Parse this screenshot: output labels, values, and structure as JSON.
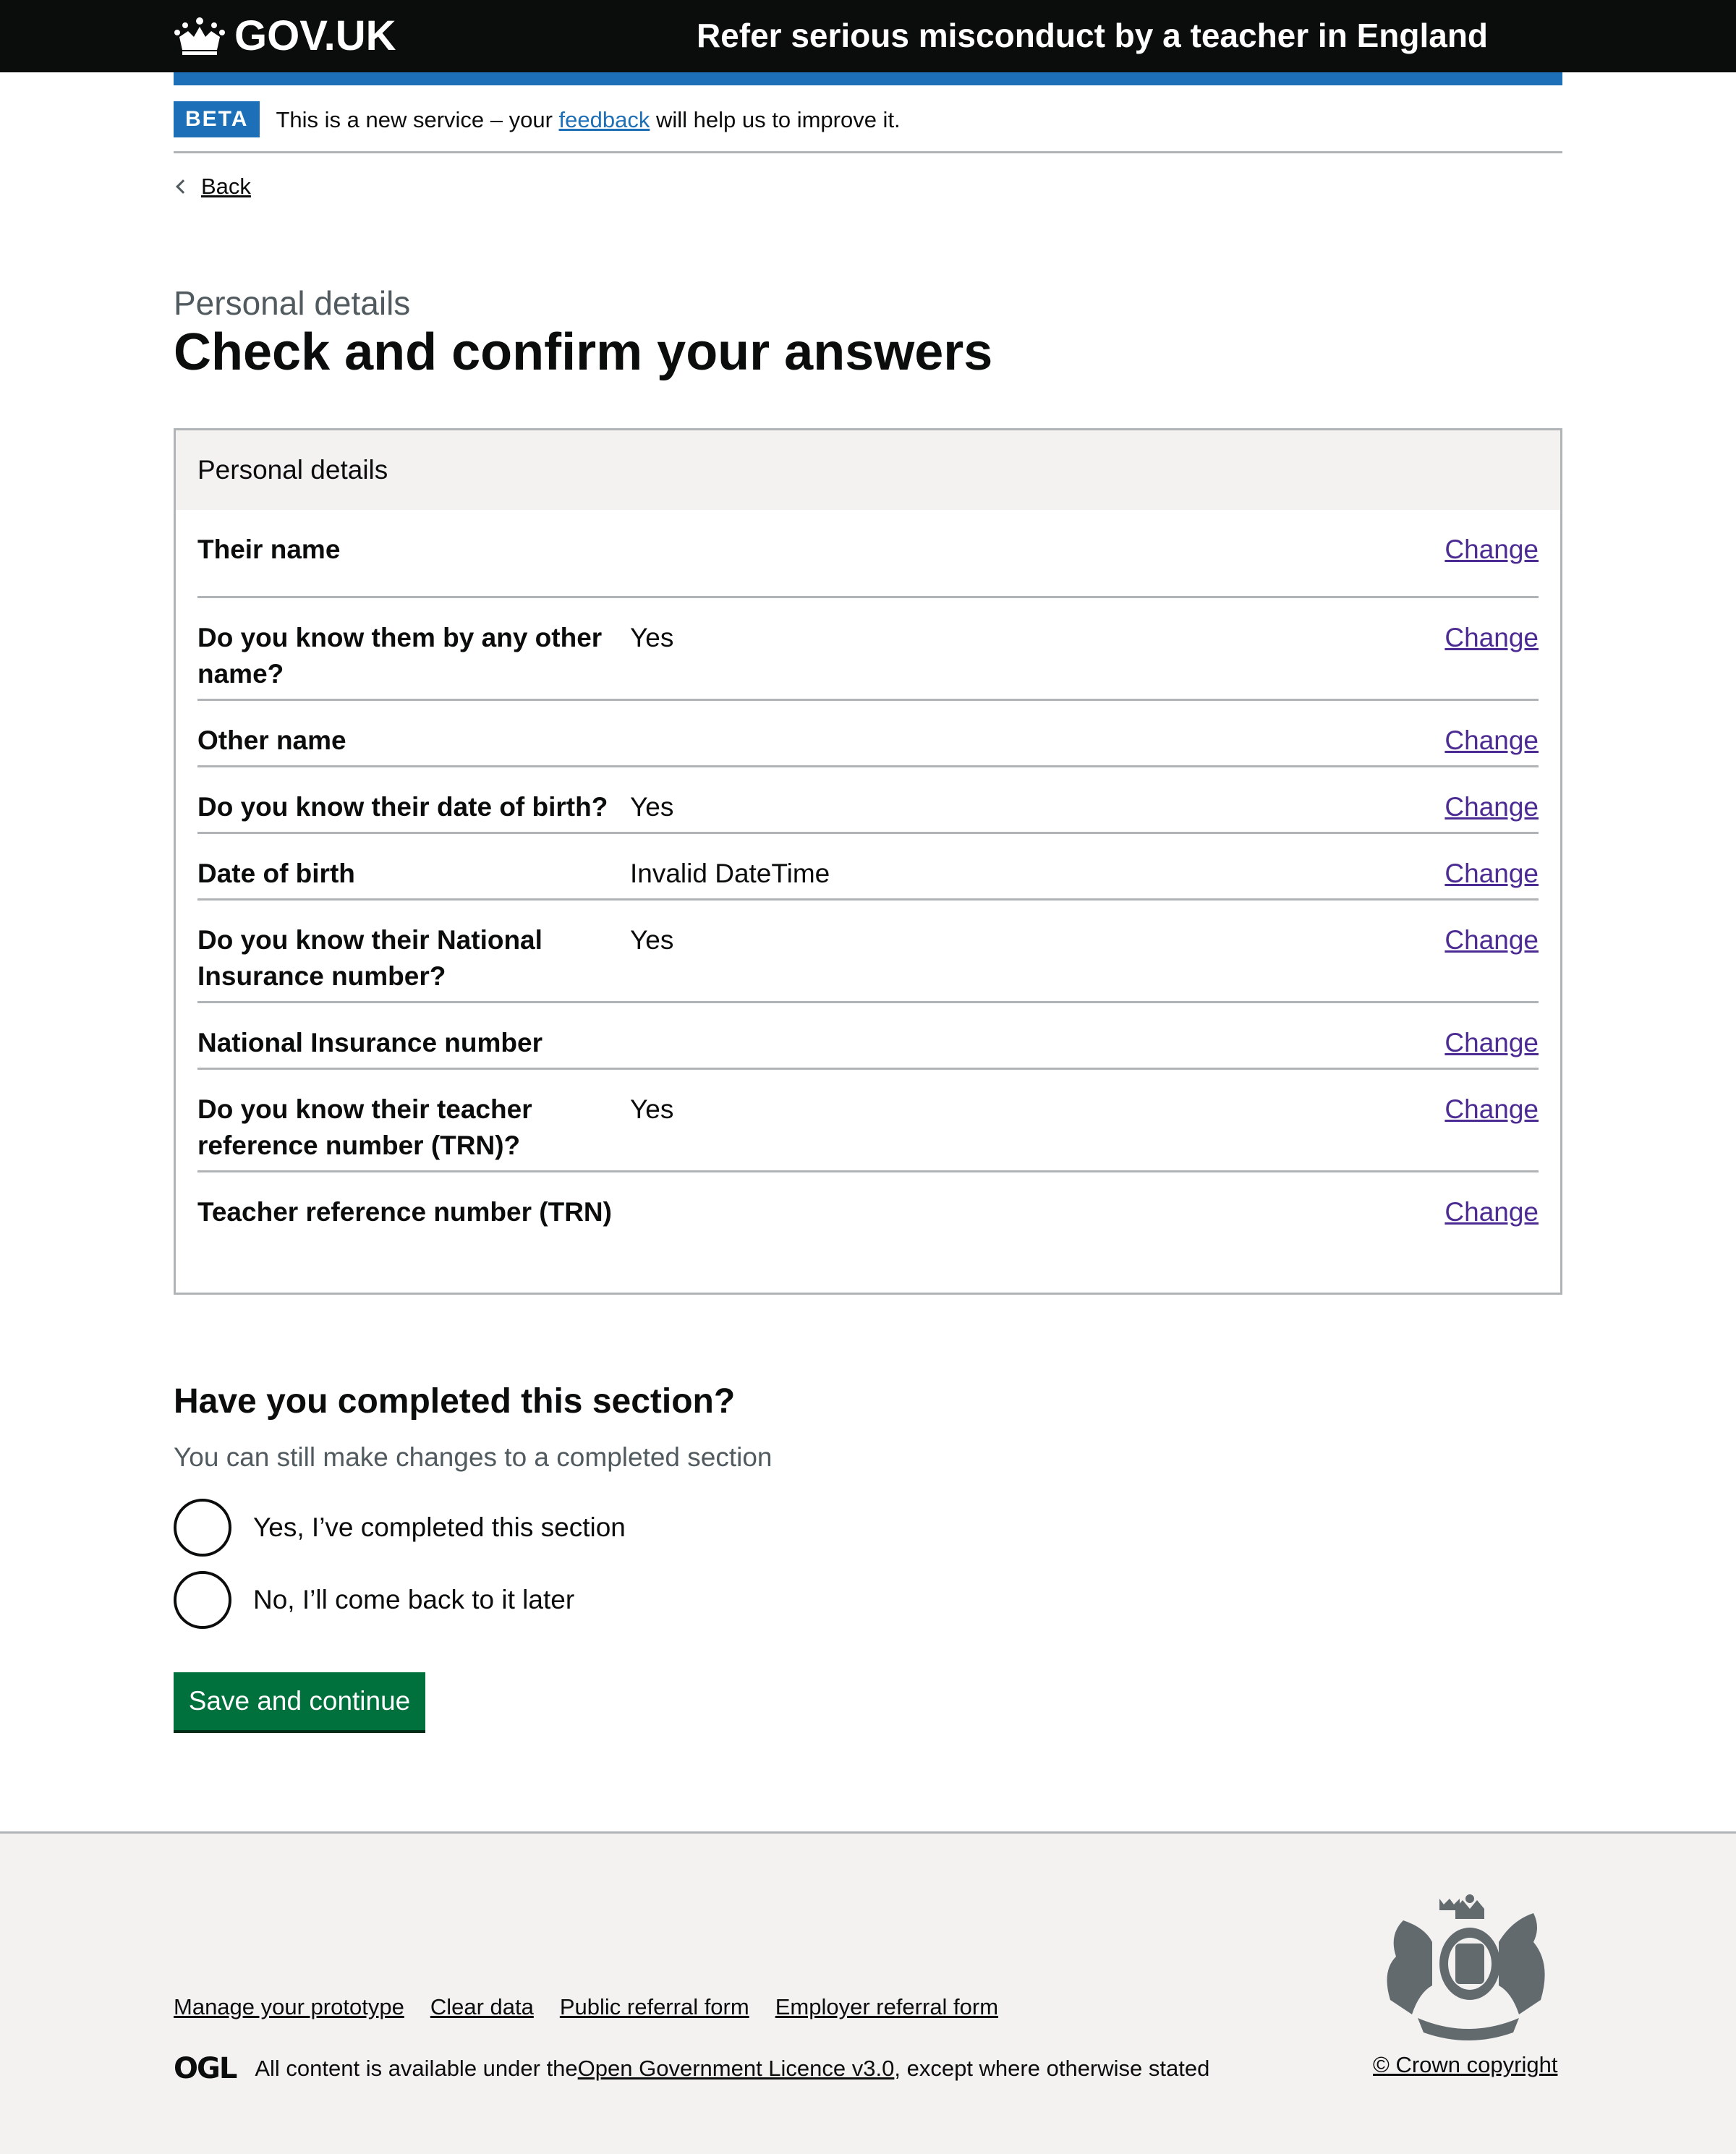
{
  "header": {
    "logo_text": "GOV.UK",
    "service_name": "Refer serious misconduct by a teacher in England"
  },
  "phase_banner": {
    "tag": "BETA",
    "text_before": "This is a new service – your ",
    "link": "feedback",
    "text_after": " will help us to improve it."
  },
  "back_link": "Back",
  "page": {
    "caption": "Personal details",
    "title": "Check and confirm your answers"
  },
  "summary_card": {
    "title": "Personal details",
    "rows": [
      {
        "key": "Their name",
        "value": "",
        "action": "Change"
      },
      {
        "key": "Do you know them by any other name?",
        "value": "Yes",
        "action": "Change"
      },
      {
        "key": "Other name",
        "value": "",
        "action": "Change"
      },
      {
        "key": "Do you know their date of birth?",
        "value": "Yes",
        "action": "Change"
      },
      {
        "key": "Date of birth",
        "value": "Invalid DateTime",
        "action": "Change"
      },
      {
        "key": "Do you know their National Insurance number?",
        "value": "Yes",
        "action": "Change"
      },
      {
        "key": "National Insurance number",
        "value": "",
        "action": "Change"
      },
      {
        "key": "Do you know their teacher reference number (TRN)?",
        "value": "Yes",
        "action": "Change"
      },
      {
        "key": "Teacher reference number (TRN)",
        "value": "",
        "action": "Change"
      }
    ]
  },
  "completion": {
    "question": "Have you completed this section?",
    "hint": "You can still make changes to a completed section",
    "options": [
      "Yes, I’ve completed this section",
      "No, I’ll come back to it later"
    ]
  },
  "submit_button": "Save and continue",
  "footer": {
    "links": [
      "Manage your prototype",
      "Clear data",
      "Public referral form",
      "Employer referral form"
    ],
    "ogl_logo": "OGL",
    "licence_before": "All content is available under the ",
    "licence_link": "Open Government Licence v3.0",
    "licence_after": ", except where otherwise stated",
    "copyright": "© Crown copyright"
  }
}
